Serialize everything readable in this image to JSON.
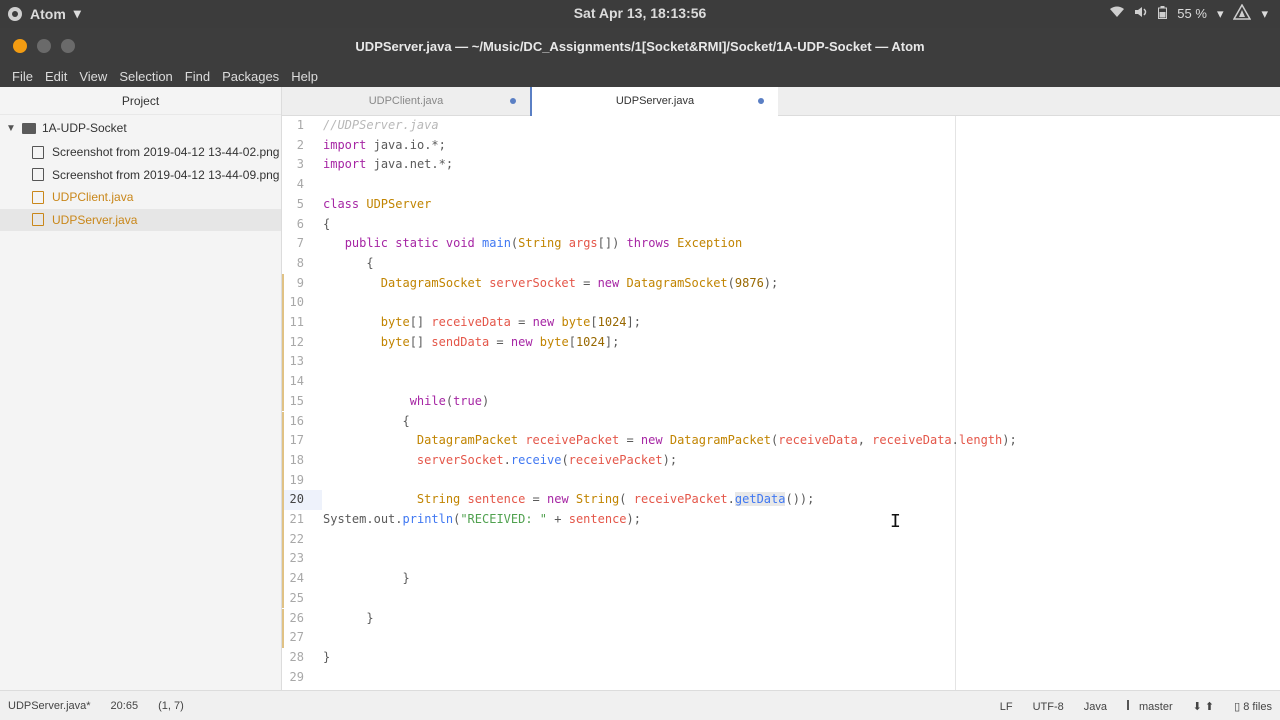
{
  "topbar": {
    "app_name": "Atom",
    "app_arrow": "▾",
    "clock": "Sat Apr 13, 18:13:56",
    "battery": "55 %",
    "icons": [
      "wifi-icon",
      "volume-icon",
      "battery-icon",
      "user-icon"
    ]
  },
  "window": {
    "title": "UDPServer.java — ~/Music/DC_Assignments/1[Socket&RMI]/Socket/1A-UDP-Socket — Atom"
  },
  "menu": {
    "items": [
      {
        "label": "File"
      },
      {
        "label": "Edit"
      },
      {
        "label": "View"
      },
      {
        "label": "Selection"
      },
      {
        "label": "Find"
      },
      {
        "label": "Packages"
      },
      {
        "label": "Help"
      }
    ]
  },
  "tree": {
    "header": "Project",
    "root": "1A-UDP-Socket",
    "files": [
      {
        "label": "Screenshot from 2019-04-12 13-44-02.png",
        "modified": false,
        "selected": false
      },
      {
        "label": "Screenshot from 2019-04-12 13-44-09.png",
        "modified": false,
        "selected": false
      },
      {
        "label": "UDPClient.java",
        "modified": true,
        "selected": false
      },
      {
        "label": "UDPServer.java",
        "modified": true,
        "selected": true
      }
    ]
  },
  "tabs": [
    {
      "label": "UDPClient.java",
      "active": false
    },
    {
      "label": "UDPServer.java",
      "active": true
    }
  ],
  "editor": {
    "current_line": 20,
    "lines": [
      {
        "n": "1",
        "text": "//UDPServer.java"
      },
      {
        "n": "2",
        "text": "import java.io.*;"
      },
      {
        "n": "3",
        "text": "import java.net.*;"
      },
      {
        "n": "4",
        "text": ""
      },
      {
        "n": "5",
        "text": "class UDPServer"
      },
      {
        "n": "6",
        "text": "{"
      },
      {
        "n": "7",
        "text": "   public static void main(String args[]) throws Exception"
      },
      {
        "n": "8",
        "text": "      {"
      },
      {
        "n": "9",
        "text": "        DatagramSocket serverSocket = new DatagramSocket(9876);"
      },
      {
        "n": "10",
        "text": ""
      },
      {
        "n": "11",
        "text": "        byte[] receiveData = new byte[1024];"
      },
      {
        "n": "12",
        "text": "        byte[] sendData = new byte[1024];"
      },
      {
        "n": "13",
        "text": ""
      },
      {
        "n": "14",
        "text": ""
      },
      {
        "n": "15",
        "text": "            while(true)"
      },
      {
        "n": "16",
        "text": "           {"
      },
      {
        "n": "17",
        "text": "             DatagramPacket receivePacket = new DatagramPacket(receiveData, receiveData.length);"
      },
      {
        "n": "18",
        "text": "             serverSocket.receive(receivePacket);"
      },
      {
        "n": "19",
        "text": ""
      },
      {
        "n": "20",
        "text": "             String sentence = new String( receivePacket.getData());"
      },
      {
        "n": "21",
        "text": "System.out.println(\"RECEIVED: \" + sentence);"
      },
      {
        "n": "22",
        "text": ""
      },
      {
        "n": "23",
        "text": ""
      },
      {
        "n": "24",
        "text": "           }"
      },
      {
        "n": "25",
        "text": ""
      },
      {
        "n": "26",
        "text": "      }"
      },
      {
        "n": "27",
        "text": ""
      },
      {
        "n": "28",
        "text": "}"
      },
      {
        "n": "29",
        "text": ""
      }
    ]
  },
  "status": {
    "file": "UDPServer.java*",
    "cursor": "20:65",
    "selection": "(1, 7)",
    "line_ending": "LF",
    "encoding": "UTF-8",
    "grammar": "Java",
    "branch": "master",
    "files": "8 files"
  }
}
